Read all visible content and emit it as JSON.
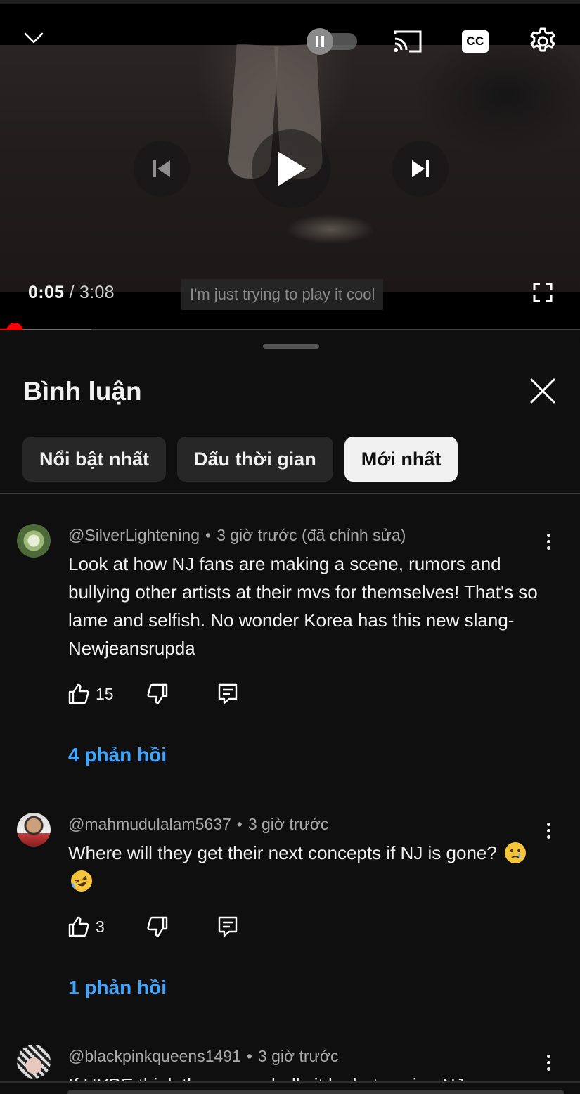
{
  "player": {
    "current_time": "0:05",
    "separator": "/",
    "duration": "3:08",
    "caption_text": "I'm just trying to play it cool",
    "progress_played_fraction": 0.026,
    "progress_buffered_fraction": 0.158,
    "icons": {
      "minimize": "chevron-down-icon",
      "autoplay": "autoplay-toggle",
      "cast": "cast-icon",
      "captions": "cc-icon",
      "settings": "gear-icon",
      "previous": "previous-icon",
      "play": "play-icon",
      "next": "next-icon",
      "fullscreen": "fullscreen-icon"
    },
    "cc_label": "CC",
    "accent_color": "#ff0000"
  },
  "comments_panel": {
    "title": "Bình luận",
    "close_icon": "close-icon",
    "sort_chips": [
      {
        "label": "Nổi bật nhất",
        "active": false
      },
      {
        "label": "Dấu thời gian",
        "active": false
      },
      {
        "label": "Mới nhất",
        "active": true
      }
    ],
    "comments": [
      {
        "author": "@SilverLightening",
        "dot": "•",
        "time": "3 giờ trước (đã chỉnh sửa)",
        "text": "Look at how NJ fans are making a scene, rumors and bullying other artists at their mvs for themselves! That's so lame and selfish. No wonder Korea has this new slang-Newjeansrupda",
        "likes": "15",
        "replies": "4 phản hồi"
      },
      {
        "author": "@mahmudulalam5637",
        "dot": "•",
        "time": "3 giờ trước",
        "text": "Where will they get their next concepts if NJ is gone?",
        "emojis": [
          "crying-face-emoji",
          "rolling-on-floor-laughing-emoji"
        ],
        "likes": "3",
        "replies": "1 phản hồi"
      },
      {
        "author": "@blackpinkqueens1491",
        "dot": "•",
        "time": "3 giờ trước",
        "text": "If HYBE think they can... bully it by hate using NJ..."
      }
    ],
    "link_color": "#3ea6ff"
  }
}
